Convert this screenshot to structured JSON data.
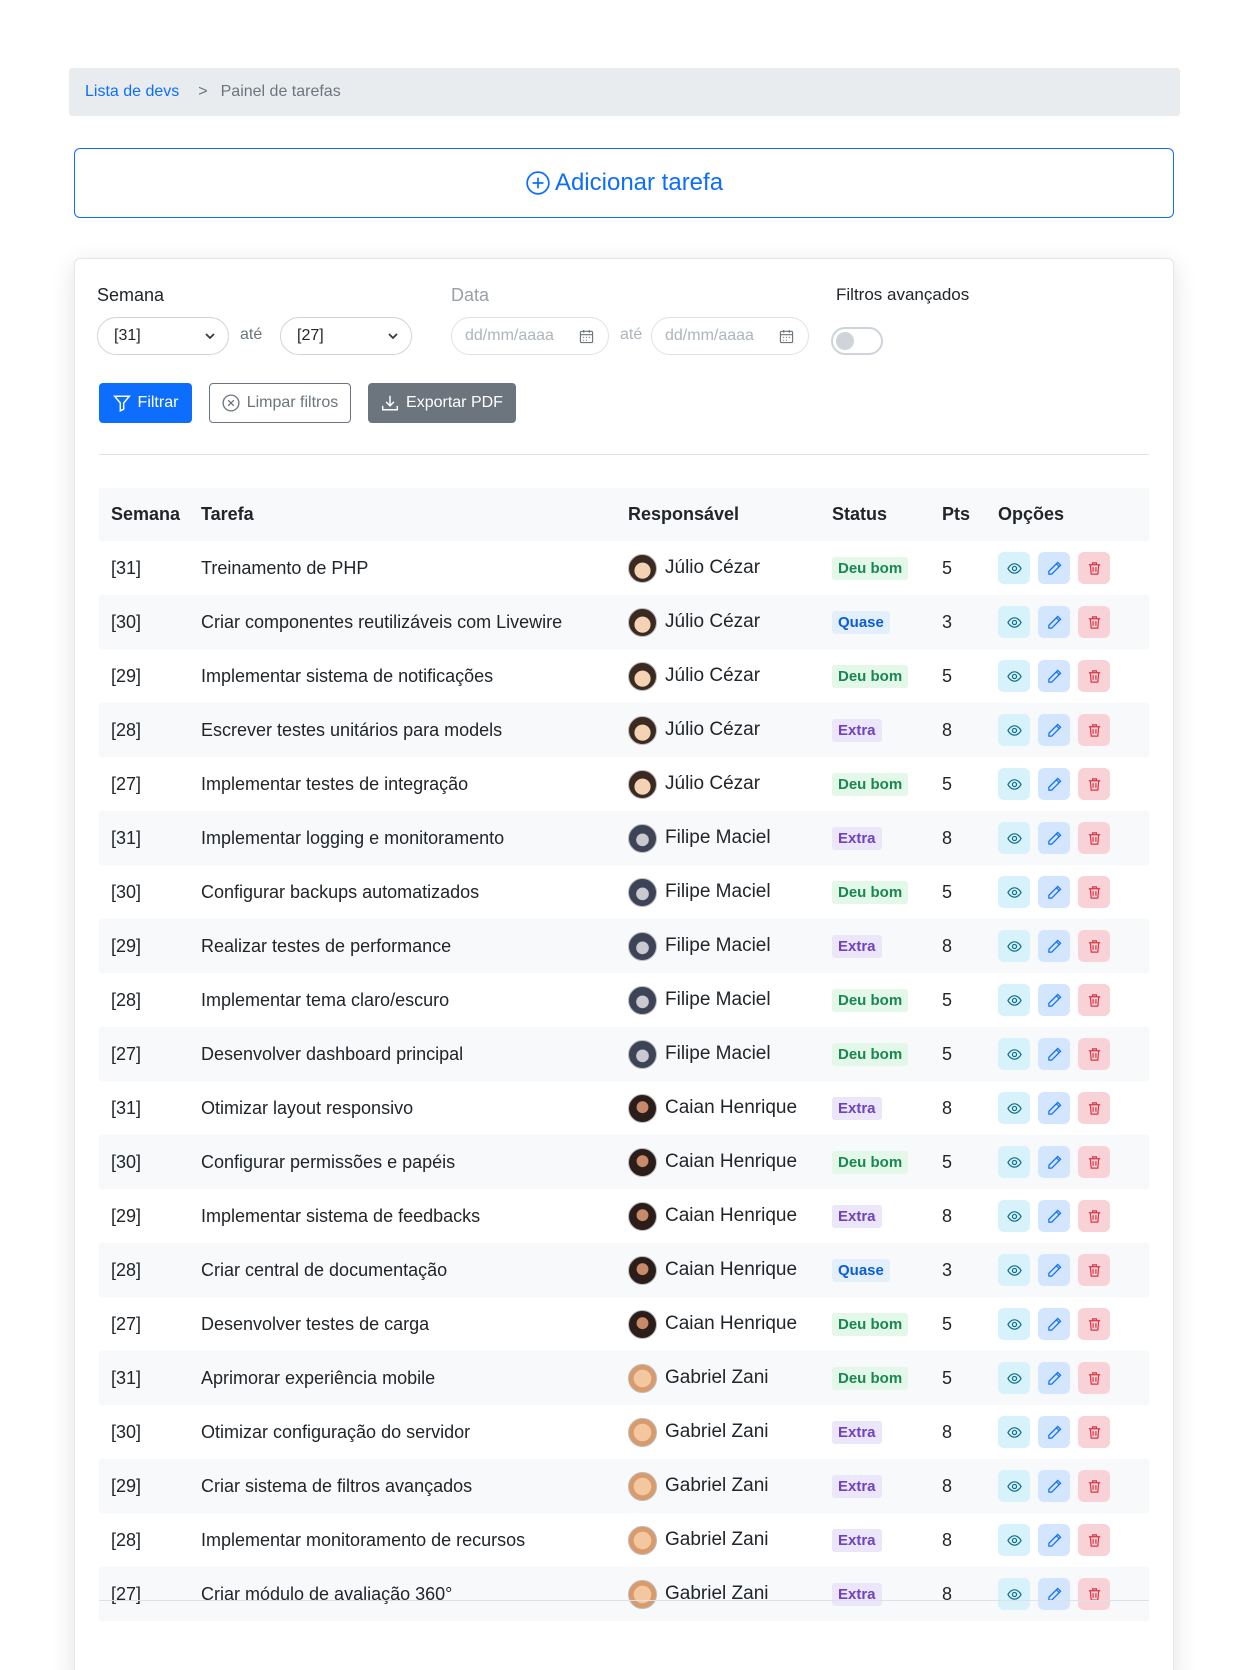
{
  "breadcrumb": {
    "link": "Lista de devs",
    "separator": ">",
    "current": "Painel de tarefas"
  },
  "add_task": {
    "label": "Adicionar tarefa"
  },
  "filters": {
    "week_label": "Semana",
    "week_from": "[31]",
    "week_between": "até",
    "week_to": "[27]",
    "date_label": "Data",
    "date_from_placeholder": "dd/mm/aaaa",
    "date_between": "até",
    "date_to_placeholder": "dd/mm/aaaa",
    "advanced_label": "Filtros avançados",
    "advanced_enabled": false
  },
  "actions": {
    "filter": "Filtrar",
    "clear": "Limpar filtros",
    "export": "Exportar PDF"
  },
  "table": {
    "headers": [
      "Semana",
      "Tarefa",
      "Responsável",
      "Status",
      "Pts",
      "Opções"
    ],
    "rows": [
      {
        "week": "[31]",
        "task": "Treinamento de PHP",
        "owner": "Júlio Cézar",
        "status": "Deu bom",
        "pts": "5"
      },
      {
        "week": "[30]",
        "task": "Criar componentes reutilizáveis com Livewire",
        "owner": "Júlio Cézar",
        "status": "Quase",
        "pts": "3"
      },
      {
        "week": "[29]",
        "task": "Implementar sistema de notificações",
        "owner": "Júlio Cézar",
        "status": "Deu bom",
        "pts": "5"
      },
      {
        "week": "[28]",
        "task": "Escrever testes unitários para models",
        "owner": "Júlio Cézar",
        "status": "Extra",
        "pts": "8"
      },
      {
        "week": "[27]",
        "task": "Implementar testes de integração",
        "owner": "Júlio Cézar",
        "status": "Deu bom",
        "pts": "5"
      },
      {
        "week": "[31]",
        "task": "Implementar logging e monitoramento",
        "owner": "Filipe Maciel",
        "status": "Extra",
        "pts": "8"
      },
      {
        "week": "[30]",
        "task": "Configurar backups automatizados",
        "owner": "Filipe Maciel",
        "status": "Deu bom",
        "pts": "5"
      },
      {
        "week": "[29]",
        "task": "Realizar testes de performance",
        "owner": "Filipe Maciel",
        "status": "Extra",
        "pts": "8"
      },
      {
        "week": "[28]",
        "task": "Implementar tema claro/escuro",
        "owner": "Filipe Maciel",
        "status": "Deu bom",
        "pts": "5"
      },
      {
        "week": "[27]",
        "task": "Desenvolver dashboard principal",
        "owner": "Filipe Maciel",
        "status": "Deu bom",
        "pts": "5"
      },
      {
        "week": "[31]",
        "task": "Otimizar layout responsivo",
        "owner": "Caian Henrique",
        "status": "Extra",
        "pts": "8"
      },
      {
        "week": "[30]",
        "task": "Configurar permissões e papéis",
        "owner": "Caian Henrique",
        "status": "Deu bom",
        "pts": "5"
      },
      {
        "week": "[29]",
        "task": "Implementar sistema de feedbacks",
        "owner": "Caian Henrique",
        "status": "Extra",
        "pts": "8"
      },
      {
        "week": "[28]",
        "task": "Criar central de documentação",
        "owner": "Caian Henrique",
        "status": "Quase",
        "pts": "3"
      },
      {
        "week": "[27]",
        "task": "Desenvolver testes de carga",
        "owner": "Caian Henrique",
        "status": "Deu bom",
        "pts": "5"
      },
      {
        "week": "[31]",
        "task": "Aprimorar experiência mobile",
        "owner": "Gabriel Zani",
        "status": "Deu bom",
        "pts": "5"
      },
      {
        "week": "[30]",
        "task": "Otimizar configuração do servidor",
        "owner": "Gabriel Zani",
        "status": "Extra",
        "pts": "8"
      },
      {
        "week": "[29]",
        "task": "Criar sistema de filtros avançados",
        "owner": "Gabriel Zani",
        "status": "Extra",
        "pts": "8"
      },
      {
        "week": "[28]",
        "task": "Implementar monitoramento de recursos",
        "owner": "Gabriel Zani",
        "status": "Extra",
        "pts": "8"
      },
      {
        "week": "[27]",
        "task": "Criar módulo de avaliação 360°",
        "owner": "Gabriel Zani",
        "status": "Extra",
        "pts": "8"
      }
    ]
  },
  "colors": {
    "primary": "#0d6efd",
    "secondary": "#6c757d",
    "success": "#198754",
    "danger": "#dc3545",
    "purple": "#6f42c1"
  },
  "icons": {
    "add": "plus-circle-icon",
    "filter": "funnel-icon",
    "clear": "x-circle-icon",
    "export": "download-icon",
    "view": "eye-icon",
    "edit": "pencil-icon",
    "delete": "trash-icon"
  }
}
